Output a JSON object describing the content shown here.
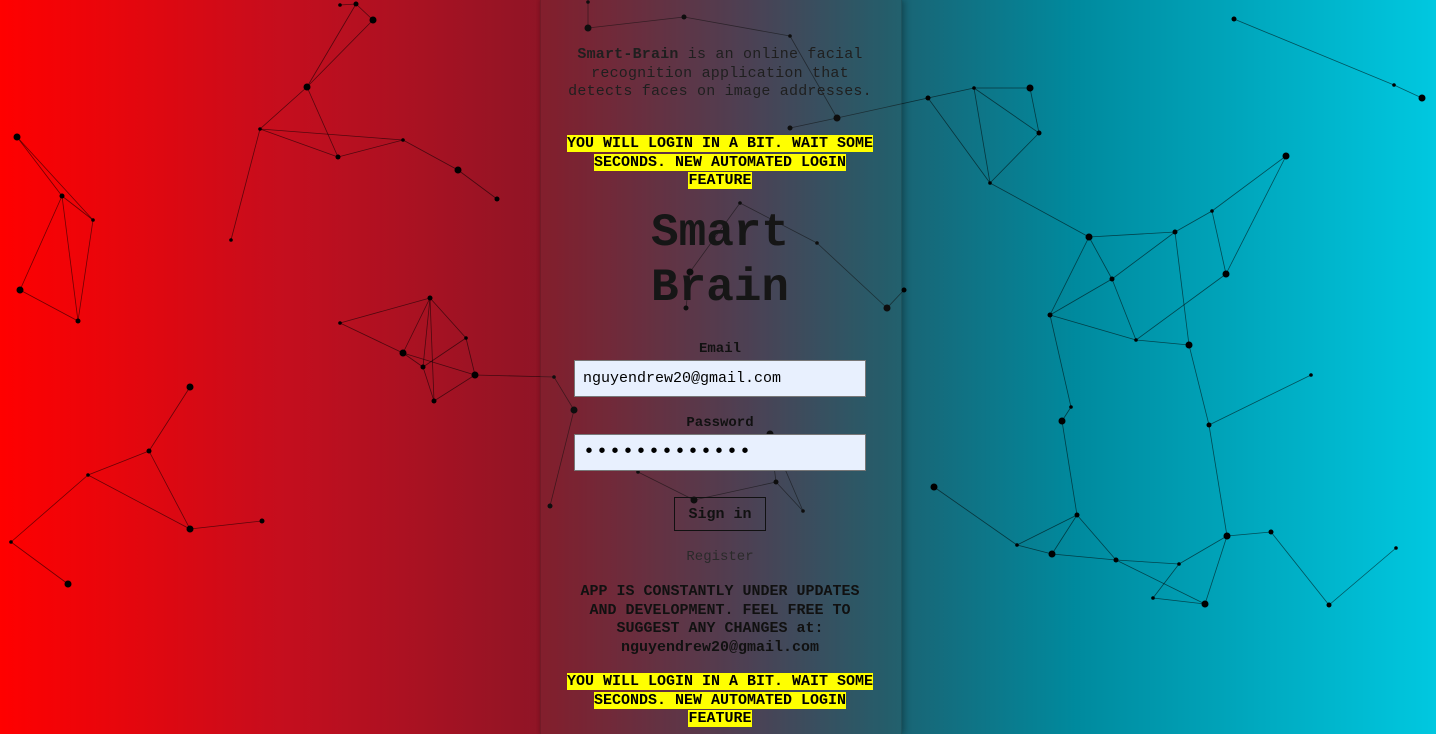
{
  "intro": {
    "app_name": "Smart-Brain",
    "description": " is an online facial recognition application that detects faces on image addresses."
  },
  "notice_top": "YOU WILL LOGIN IN A BIT. WAIT SOME SECONDS. NEW AUTOMATED LOGIN FEATURE",
  "title": "Smart Brain",
  "form": {
    "email_label": "Email",
    "email_value": "nguyendrew20@gmail.com",
    "password_label": "Password",
    "password_value": "•••••••••••••",
    "signin_label": "Sign in",
    "register_label": "Register"
  },
  "updates_text": "APP IS CONSTANTLY UNDER UPDATES AND DEVELOPMENT. FEEL FREE TO SUGGEST ANY CHANGES at: nguyendrew20@gmail.com",
  "notice_bottom": "YOU WILL LOGIN IN A BIT. WAIT SOME SECONDS. NEW AUTOMATED LOGIN FEATURE",
  "colors": {
    "gradient_left": "#ff0000",
    "gradient_right": "#00c8e0",
    "highlight": "#ffff00",
    "input_bg": "#e8f0fe"
  }
}
